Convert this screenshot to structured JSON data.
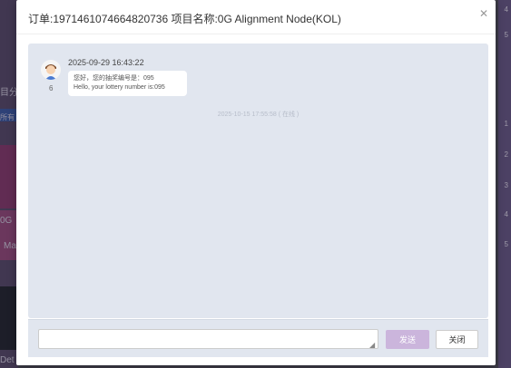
{
  "background": {
    "left_texts": [
      "目分",
      "所有",
      "0G",
      "Ma",
      "Det"
    ],
    "right_numbers": [
      "4",
      "5",
      "1",
      "2",
      "3",
      "4",
      "5"
    ]
  },
  "modal": {
    "title": "订单:1971461074664820736 项目名称:0G Alignment Node(KOL)",
    "close_icon": "close-icon"
  },
  "chat": {
    "messages": [
      {
        "avatar_id": "6",
        "timestamp": "2025-09-29 16:43:22",
        "lines": [
          "您好，您的抽奖编号是：095",
          "Hello, your lottery number is:095"
        ]
      }
    ],
    "status_line": "2025-10-15 17:55:58 ( 在线 )"
  },
  "footer": {
    "input_value": "",
    "input_placeholder": "",
    "send_label": "发送",
    "close_label": "关闭"
  },
  "colors": {
    "chat_bg": "#e1e6ef",
    "send_button": "#cbb5dc"
  }
}
